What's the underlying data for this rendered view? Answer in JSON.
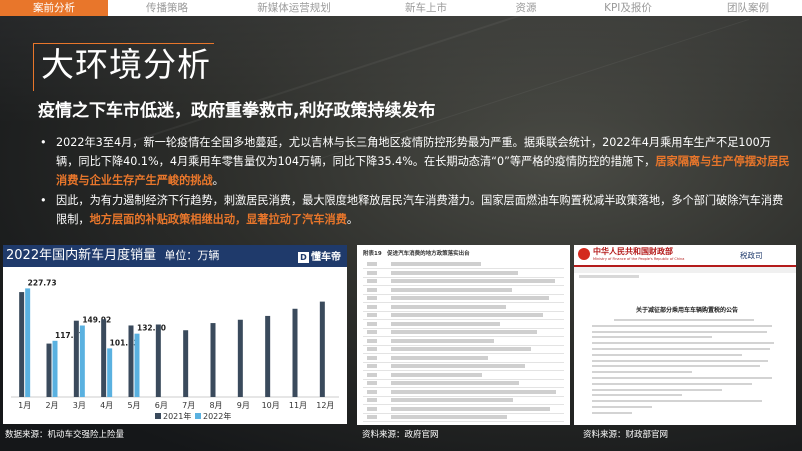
{
  "nav": {
    "tabs": [
      "案前分析",
      "传播策略",
      "新媒体运营规划",
      "新车上市",
      "资源",
      "KPI及报价",
      "团队案例"
    ],
    "active_index": 0
  },
  "title": "大环境分析",
  "subtitle": "疫情之下车市低迷，政府重拳救市,利好政策持续发布",
  "bullets": {
    "b1": {
      "dot": "•",
      "text": "2022年3至4月，新一轮疫情在全国多地蔓延，尤以吉林与长三角地区疫情防控形势最为严重。据乘联会统计，2022年4月乘用车生产不足100万辆，同比下降40.1%，4月乘用车零售量仅为104万辆，同比下降35.4%。在长期动态清“0”等严格的疫情防控的措施下，",
      "highlight": "居家隔离与生产停摆对居民消费与企业生存产生严峻的挑战",
      "end": "。"
    },
    "b2": {
      "dot": "•",
      "text": "因此，为有力遏制经济下行趋势，刺激居民消费，最大限度地释放居民汽车消费潜力。国家层面燃油车购置税减半政策落地，多个部门破除汽车消费限制，",
      "highlight": "地方层面的补贴政策相继出动，显著拉动了汽车消费",
      "end": "。"
    }
  },
  "chart": {
    "title": "2022年国内新车月度销量",
    "unit": "单位：万辆",
    "logo": "懂车帝",
    "logo_mark": "D",
    "source": "数据来源：机动车交强险上险量"
  },
  "chart_data": {
    "type": "bar",
    "categories": [
      "1月",
      "2月",
      "3月",
      "4月",
      "5月",
      "6月",
      "7月",
      "8月",
      "9月",
      "10月",
      "11月",
      "12月"
    ],
    "series": [
      {
        "name": "2021年",
        "color": "#3a4a5c",
        "values": [
          220,
          112,
          160,
          163,
          150,
          152,
          140,
          155,
          162,
          170,
          185,
          200
        ]
      },
      {
        "name": "2022年",
        "color": "#5ab1e0",
        "values": [
          227.73,
          117.87,
          149.92,
          101.93,
          132.8,
          null,
          null,
          null,
          null,
          null,
          null,
          null
        ]
      }
    ],
    "data_labels": [
      "227.73",
      "117.87",
      "149.92",
      "101.93",
      "132.80"
    ],
    "ylim": [
      0,
      260
    ],
    "legend": "bottom"
  },
  "doc1": {
    "caption": "附表19　促进汽车消费的地方政策落实出台",
    "source": "资料来源：政府官网"
  },
  "doc2": {
    "ministry": "中华人民共和国财政部",
    "ministry_en": "Ministry of Finance of the People's Republic of China",
    "dept": "税政司",
    "notice_title": "关于减征部分乘用车车辆购置税的公告",
    "source": "资料来源：财政部官网"
  },
  "colors": {
    "accent": "#e8762b",
    "chart_header": "#1f3a6b",
    "bar_2021": "#3a4a5c",
    "bar_2022": "#5ab1e0"
  }
}
